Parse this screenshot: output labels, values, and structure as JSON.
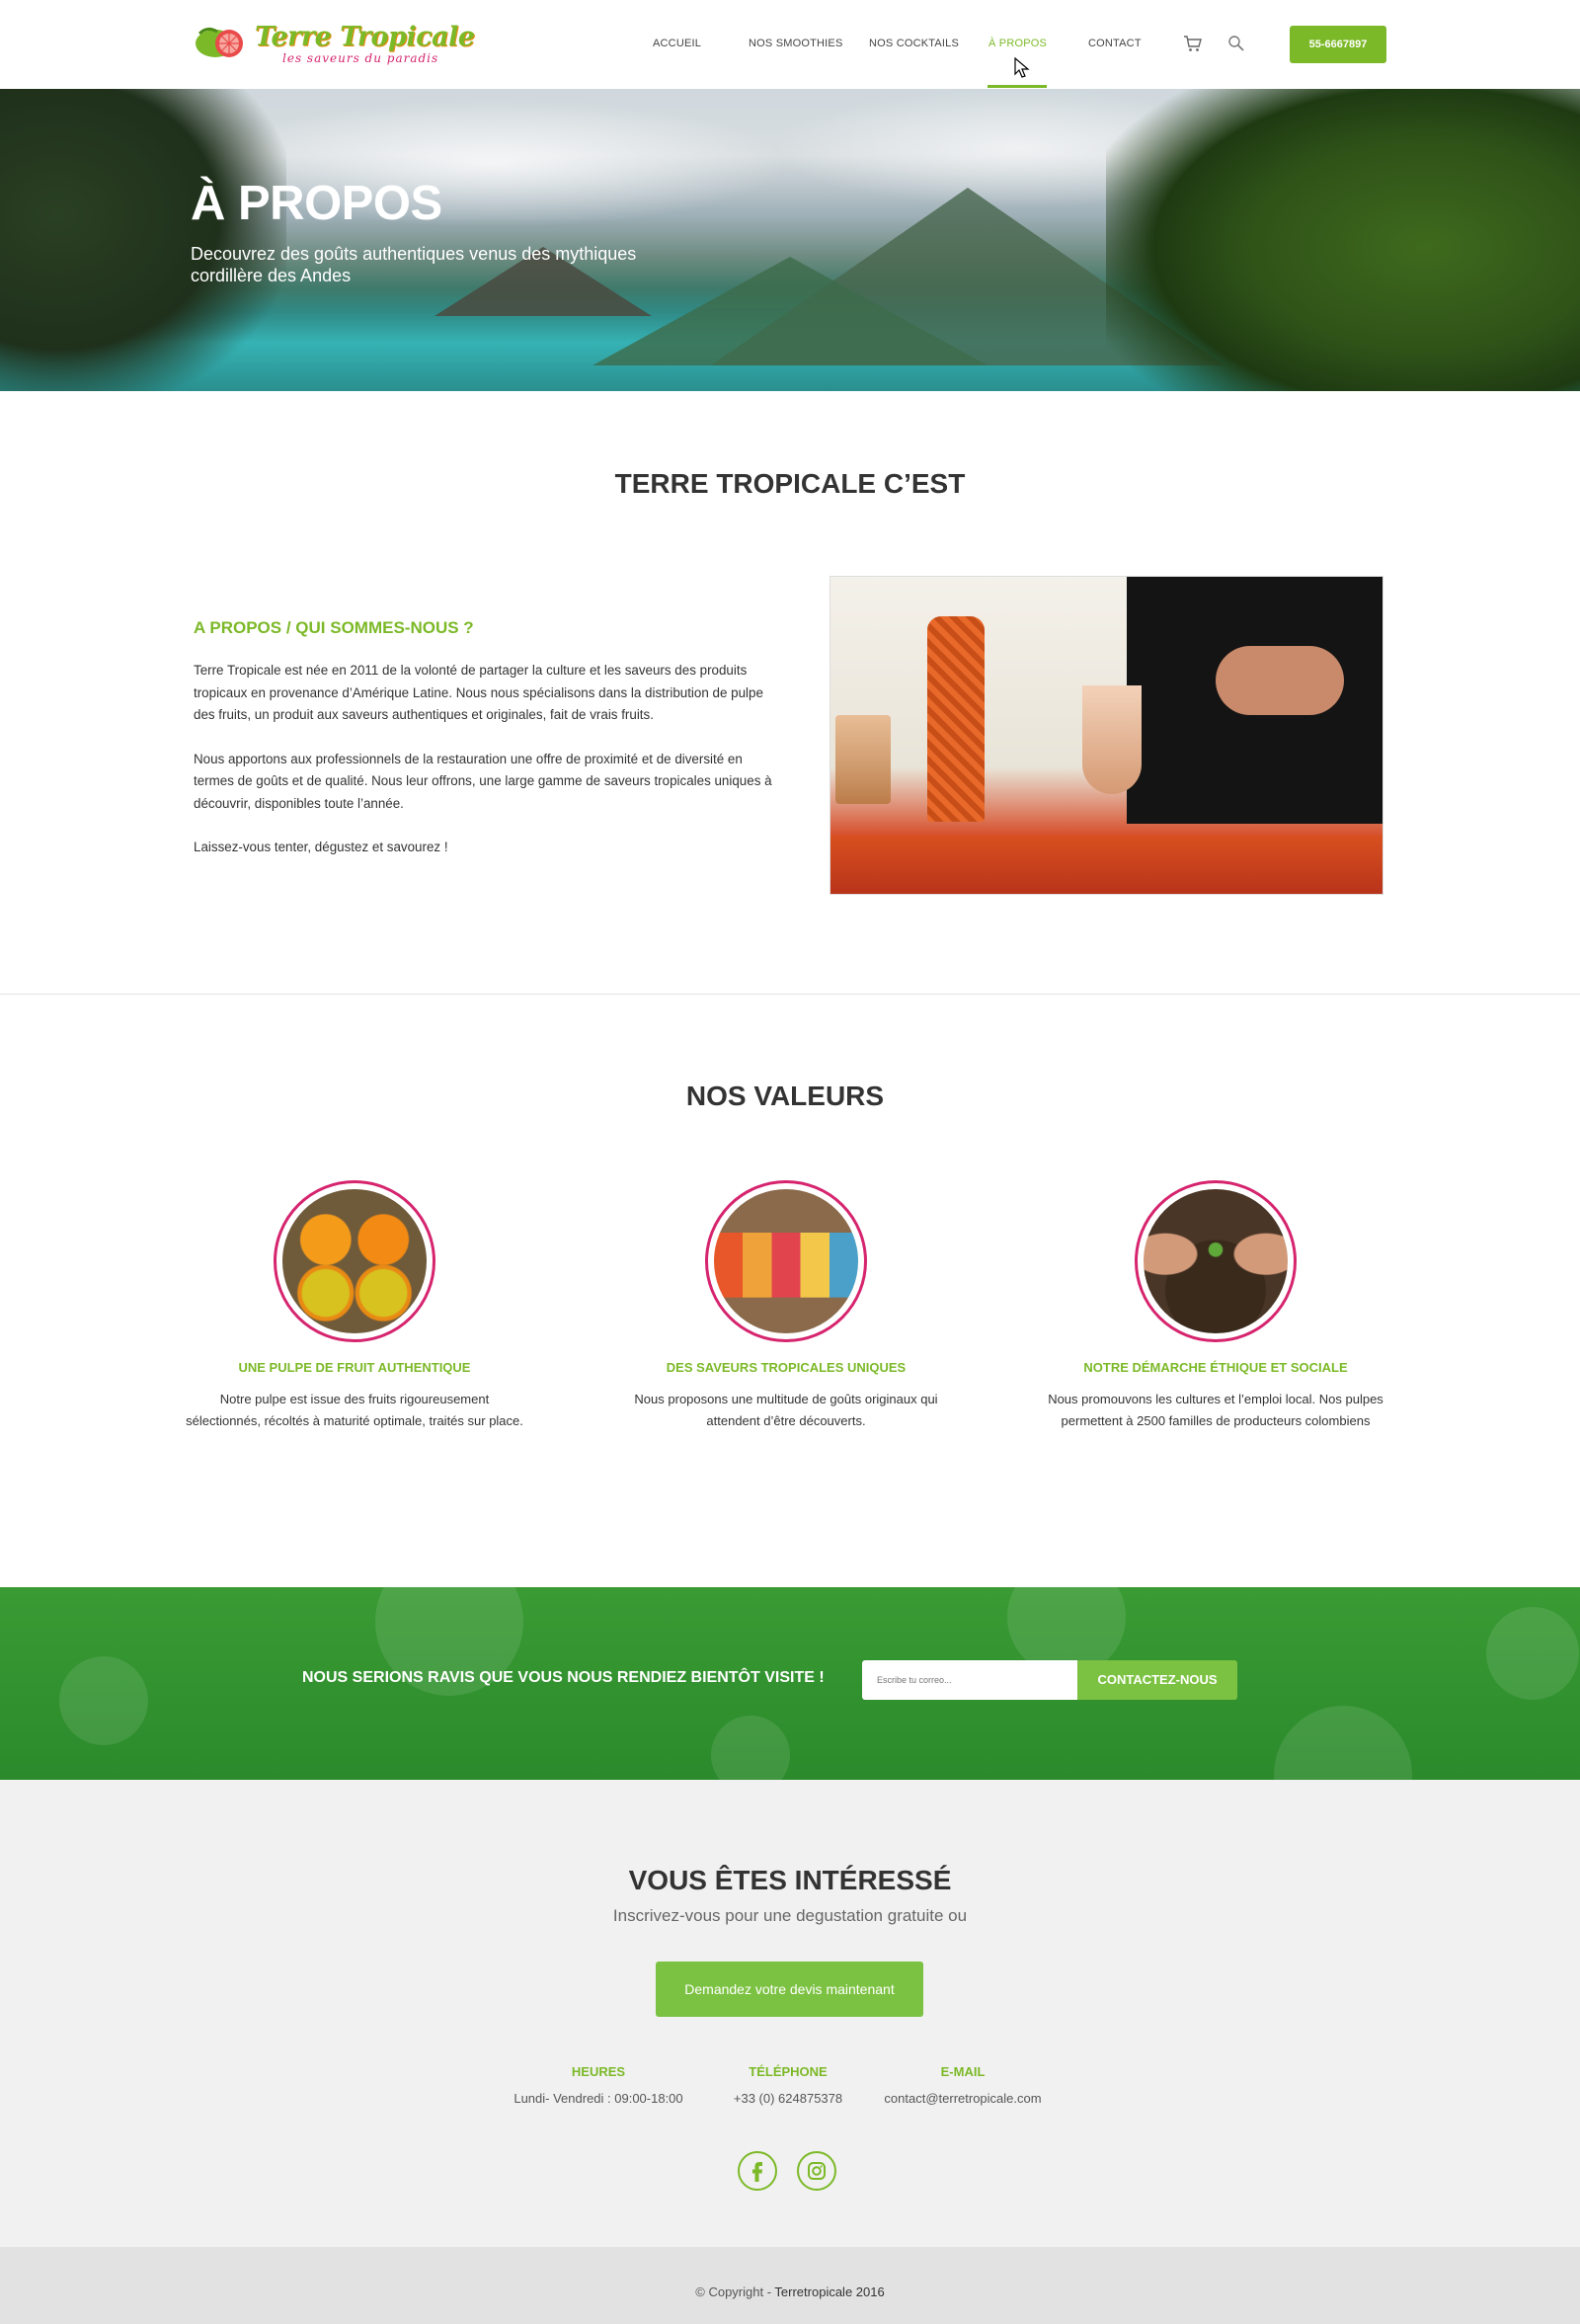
{
  "header": {
    "logo_title": "Terre Tropicale",
    "logo_tagline": "les saveurs du paradis",
    "nav": [
      {
        "label": "ACCUEIL"
      },
      {
        "label": "NOS SMOOTHIES"
      },
      {
        "label": "NOS COCKTAILS"
      },
      {
        "label": "À PROPOS"
      },
      {
        "label": "CONTACT"
      }
    ],
    "active_nav": "À PROPOS",
    "cart_icon": "cart-icon",
    "search_icon": "search-icon",
    "phone_button": "55-6667897"
  },
  "hero": {
    "title": "À PROPOS",
    "subtitle": "Decouvrez des goûts authentiques venus des mythiques cordillère des Andes"
  },
  "about": {
    "section_title": "TERRE TROPICALE C’EST",
    "heading": "A PROPOS / QUI SOMMES-NOUS ?",
    "paragraphs": [
      "Terre Tropicale est née en 2011 de la volonté de partager la culture et les saveurs des produits tropicaux en provenance d’Amérique Latine. Nous nous spécialisons dans la distribution de pulpe des fruits, un produit aux saveurs authentiques et originales, fait de vrais fruits.",
      "Nous apportons aux professionnels de la restauration une offre de proximité et de diversité en termes de goûts et de qualité. Nous leur offrons,  une large gamme de saveurs tropicales uniques à découvrir, disponibles toute l’année.",
      "Laissez-vous tenter, dégustez et savourez !"
    ]
  },
  "values": {
    "title": "NOS VALEURS",
    "items": [
      {
        "title": "UNE PULPE DE FRUIT AUTHENTIQUE",
        "text": "Notre pulpe est issue des fruits rigoureusement sélectionnés, récoltés à maturité optimale, traités sur place."
      },
      {
        "title": "DES SAVEURS TROPICALES UNIQUES",
        "text": "Nous proposons une multitude de goûts originaux qui attendent d’être découverts."
      },
      {
        "title": "NOTRE DÉMARCHE ÉTHIQUE ET SOCIALE",
        "text": "Nous promouvons les cultures et l’emploi local. Nos pulpes permettent à 2500 familles de producteurs colombiens"
      }
    ]
  },
  "newsletter": {
    "text": "NOUS SERIONS RAVIS QUE VOUS NOUS RENDIEZ BIENTÔT VISITE !",
    "input_placeholder": "Escribe tu correo...",
    "button": "CONTACTEZ-NOUS"
  },
  "contact": {
    "title": "VOUS ÊTES INTÉRESSÉ",
    "subtitle": "Inscrivez-vous pour une degustation gratuite ou",
    "button": "Demandez votre devis maintenant",
    "info": [
      {
        "label": "HEURES",
        "value": "Lundi- Vendredi : 09:00-18:00"
      },
      {
        "label": "TÉLÉPHONE",
        "value": "+33 (0) 624875378"
      },
      {
        "label": "E-MAIL",
        "value": "contact@terretropicale.com"
      }
    ],
    "social": [
      "facebook-icon",
      "instagram-icon"
    ]
  },
  "footer": {
    "copyright_prefix": "© Copyright - ",
    "copyright_name": "Terretropicale 2016"
  },
  "colors": {
    "accent_green": "#7cb928",
    "band_green": "#2b8a2b",
    "circle_border": "#d6246e",
    "footer_bg": "#e2e2e2",
    "contact_bg": "#f1f1f1"
  }
}
